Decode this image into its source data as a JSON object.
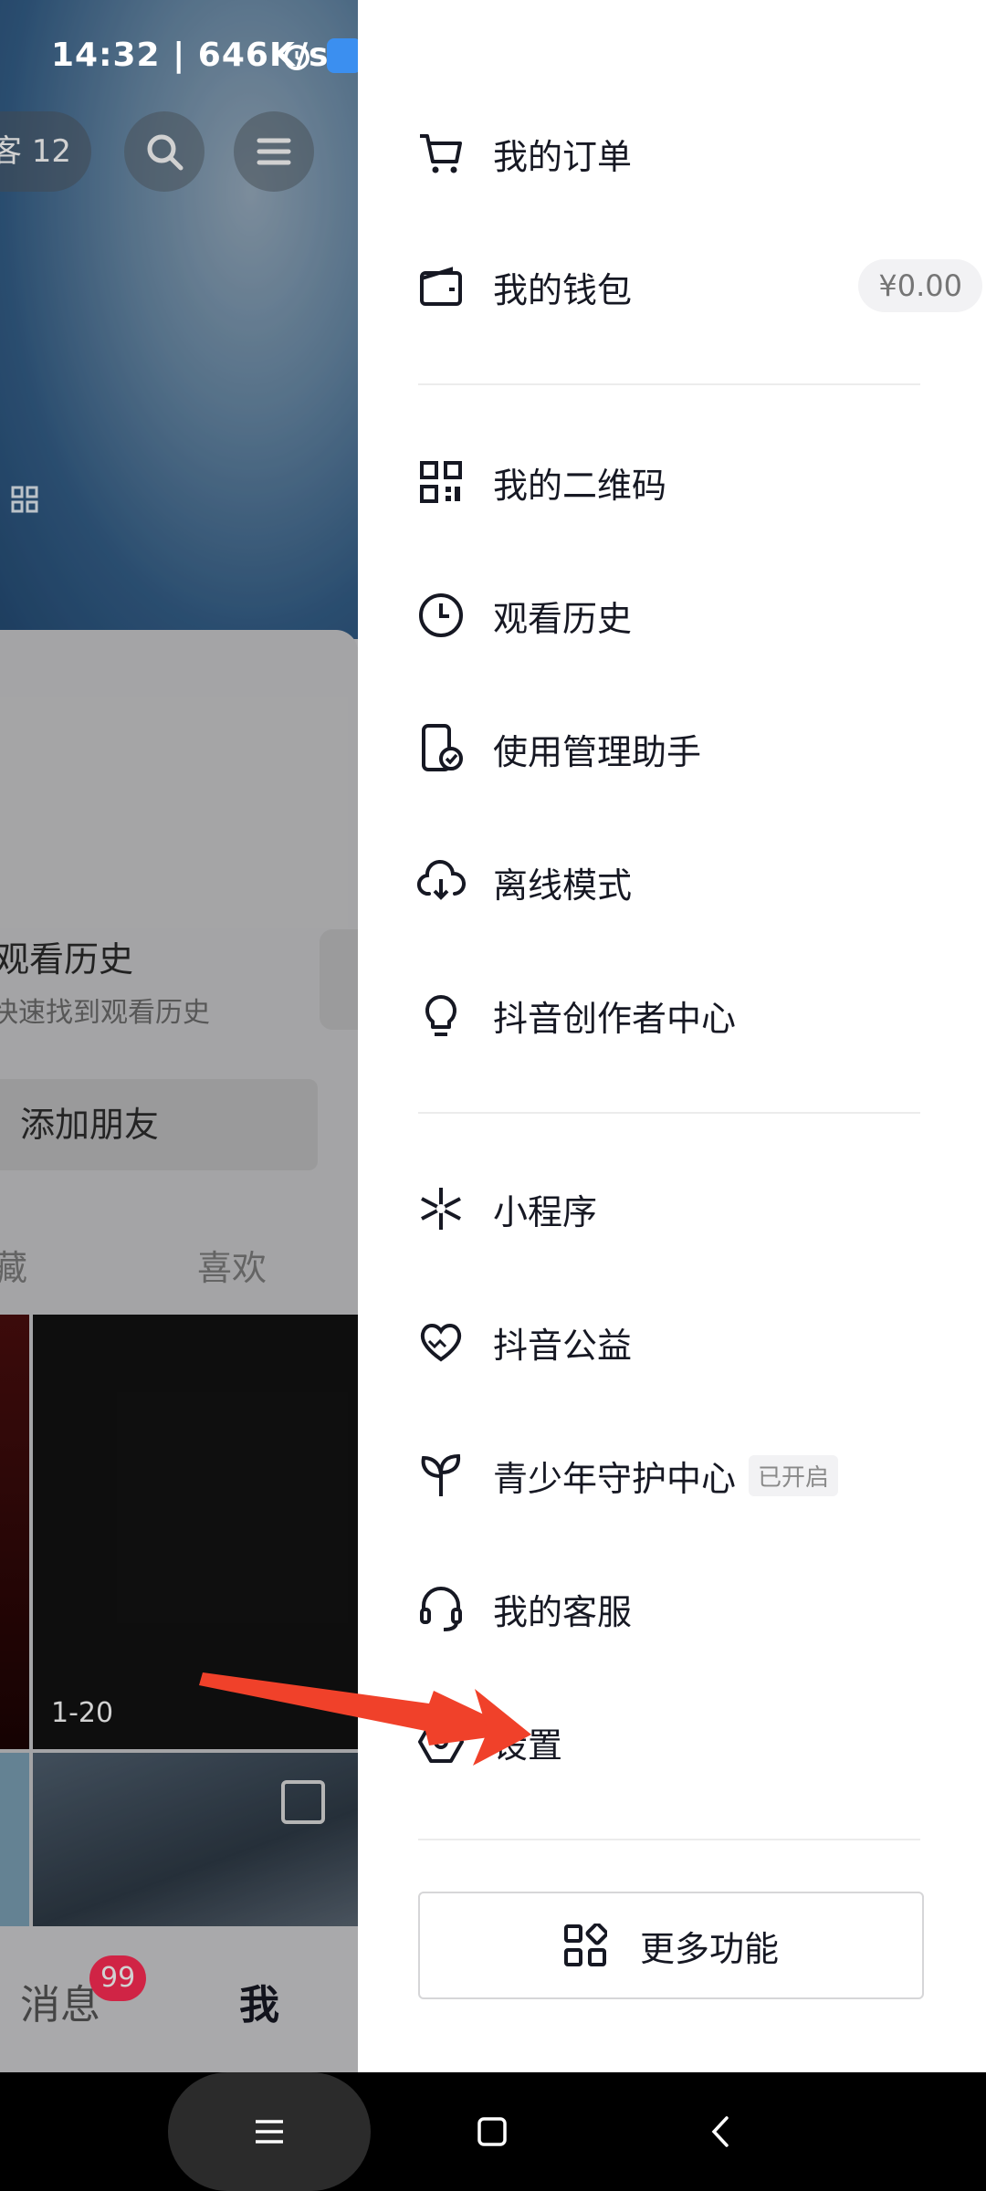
{
  "status_bar": {
    "time": "14:32 | 646K/s",
    "icons": [
      "alarm-icon",
      "app-icon",
      "douyin-icon",
      "app-icon"
    ]
  },
  "background_page": {
    "visitor_label": "客 12",
    "history_title": "观看历史",
    "history_subtitle": "快速找到观看历史",
    "add_friend": "添加朋友",
    "tabs": [
      "藏",
      "喜欢"
    ],
    "thumbnail_label": "1-20",
    "bottom_nav": {
      "messages": "消息",
      "messages_badge": "99",
      "me": "我"
    }
  },
  "drawer": {
    "items": [
      {
        "label": "我的订单",
        "icon": "cart-icon"
      },
      {
        "label": "我的钱包",
        "icon": "wallet-icon",
        "value": "¥0.00"
      },
      {
        "label": "我的二维码",
        "icon": "qr-code-icon"
      },
      {
        "label": "观看历史",
        "icon": "clock-icon"
      },
      {
        "label": "使用管理助手",
        "icon": "phone-check-icon"
      },
      {
        "label": "离线模式",
        "icon": "cloud-download-icon"
      },
      {
        "label": "抖音创作者中心",
        "icon": "lightbulb-icon"
      },
      {
        "label": "小程序",
        "icon": "mini-program-icon"
      },
      {
        "label": "抖音公益",
        "icon": "charity-heart-icon"
      },
      {
        "label": "青少年守护中心",
        "icon": "sprout-icon",
        "tag": "已开启"
      },
      {
        "label": "我的客服",
        "icon": "headset-icon"
      },
      {
        "label": "设置",
        "icon": "settings-hex-icon"
      }
    ],
    "more_button": "更多功能"
  },
  "colors": {
    "accent": "#fe2c55",
    "annotation_arrow": "#f0412a"
  }
}
